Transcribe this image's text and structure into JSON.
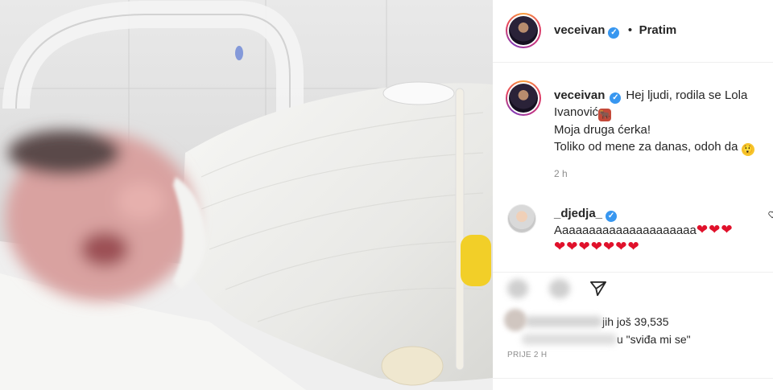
{
  "header": {
    "username": "veceivan",
    "follow_label": "Pratim",
    "separator": "•"
  },
  "caption": {
    "username": "veceivan",
    "line1": "Hej ljudi, rodila se Lola",
    "line2": "Ivanović",
    "line3": "Moja druga ćerka!",
    "line4": "Toliko od mene za danas, odoh da",
    "time": "2 h"
  },
  "comment": {
    "username": "_djedja_",
    "text": "Aaaaaaaaaaaaaaaaaaaaa",
    "hearts_inline": 3,
    "hearts_line2": 7
  },
  "likes": {
    "line1_suffix": "jih još 39,535",
    "line2_suffix": "u \"sviđa mi se\"",
    "posted": "PRIJE 2 H"
  },
  "icons": [
    "verified-badge-icon",
    "heart-icon",
    "comment-icon",
    "share-icon",
    "ox-emoji-icon",
    "astonished-emoji-icon"
  ],
  "colors": {
    "verified": "#3897f0",
    "heart": "#e0112b",
    "muted": "#8e8e8e"
  }
}
